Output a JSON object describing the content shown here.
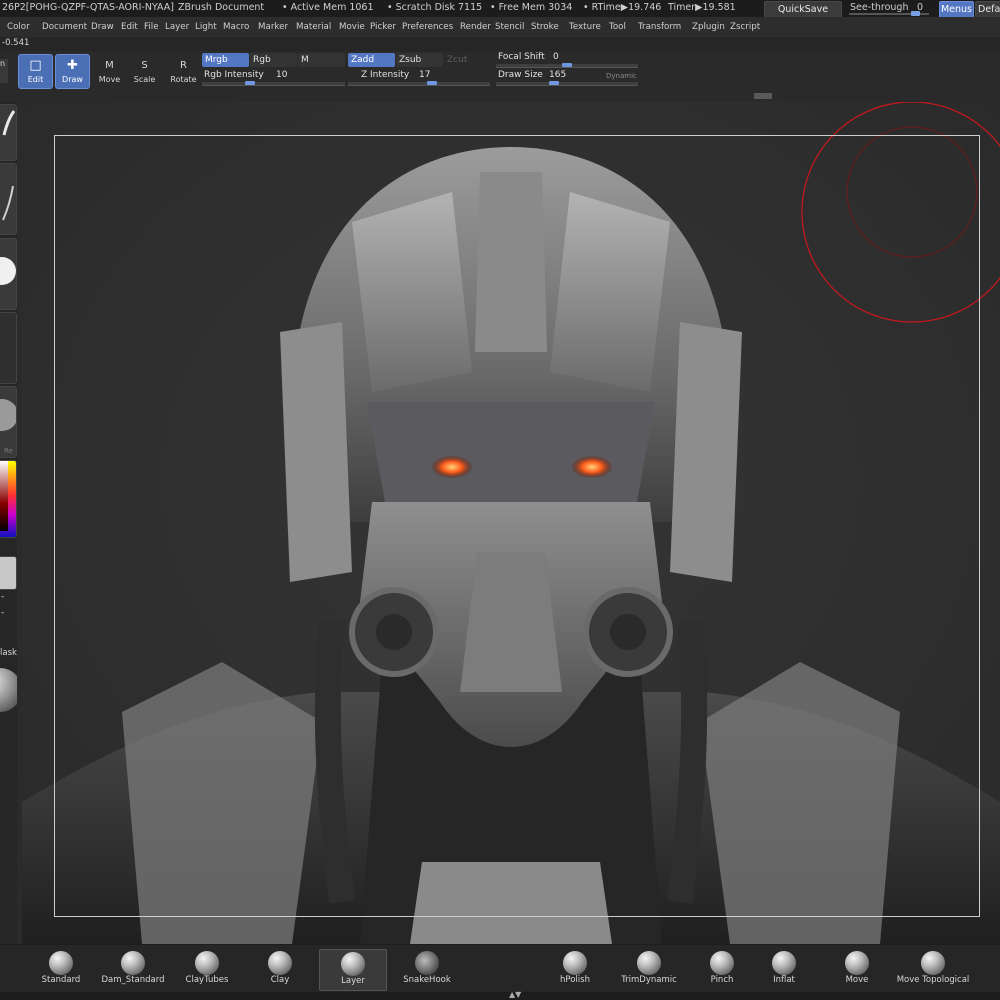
{
  "status": {
    "version_fragment": "26",
    "doc_id": "P2[POHG-QZPF-QTAS-AORI-NYAA]",
    "doc_title": "ZBrush Document",
    "active_mem": "• Active Mem 1061",
    "scratch_disk": "• Scratch Disk 7115",
    "free_mem": "• Free Mem 3034",
    "rtime": "• RTime▶19.746",
    "timer": "Timer▶19.581"
  },
  "topright": {
    "quicksave": "QuickSave",
    "see_through_label": "See-through",
    "see_through_value": "0",
    "see_through_fraction": 0,
    "menus": "Menus",
    "default_fragment": "Defa"
  },
  "menus": [
    "Color",
    "Document",
    "Draw",
    "Edit",
    "File",
    "Layer",
    "Light",
    "Macro",
    "Marker",
    "Material",
    "Movie",
    "Picker",
    "Preferences",
    "Render",
    "Stencil",
    "Stroke",
    "Texture",
    "Tool",
    "Transform",
    "Zplugin",
    "Zscript"
  ],
  "coord": {
    "value": "-0.541",
    "left_fragment": "n"
  },
  "toolbar": {
    "edit": "Edit",
    "draw": "Draw",
    "move": "Move",
    "scale": "Scale",
    "rotate": "Rotate",
    "move_key": "M",
    "scale_key": "S",
    "rotate_key": "R",
    "mrgb": "Mrgb",
    "rgb": "Rgb",
    "m": "M",
    "rgb_intensity_label": "Rgb Intensity",
    "rgb_intensity_value": "10",
    "rgb_intensity_fraction": 0.1,
    "zadd": "Zadd",
    "zsub": "Zsub",
    "zcut": "Zcut",
    "z_intensity_label": "Z Intensity",
    "z_intensity_value": "17",
    "z_intensity_fraction": 0.17,
    "focal_shift_label": "Focal Shift",
    "focal_shift_value": "0",
    "draw_size_label": "Draw Size",
    "draw_size_value": "165",
    "dynamic": "Dynamic"
  },
  "lefttray": {
    "re_label": "Re",
    "mask_label": "lask",
    "dash1": "-",
    "dash2": "-"
  },
  "brushes": [
    {
      "label": "Standard"
    },
    {
      "label": "Dam_Standard"
    },
    {
      "label": "ClayTubes"
    },
    {
      "label": "Clay"
    },
    {
      "label": "Layer"
    },
    {
      "label": "SnakeHook"
    },
    {
      "label": "hPolish"
    },
    {
      "label": "TrimDynamic"
    },
    {
      "label": "Pinch"
    },
    {
      "label": "Inflat"
    },
    {
      "label": "Move"
    },
    {
      "label": "Move Topological"
    }
  ],
  "colors": {
    "accent": "#5477c4",
    "eyes": "#ff5a1a",
    "brush_circle": "#c0191e"
  }
}
